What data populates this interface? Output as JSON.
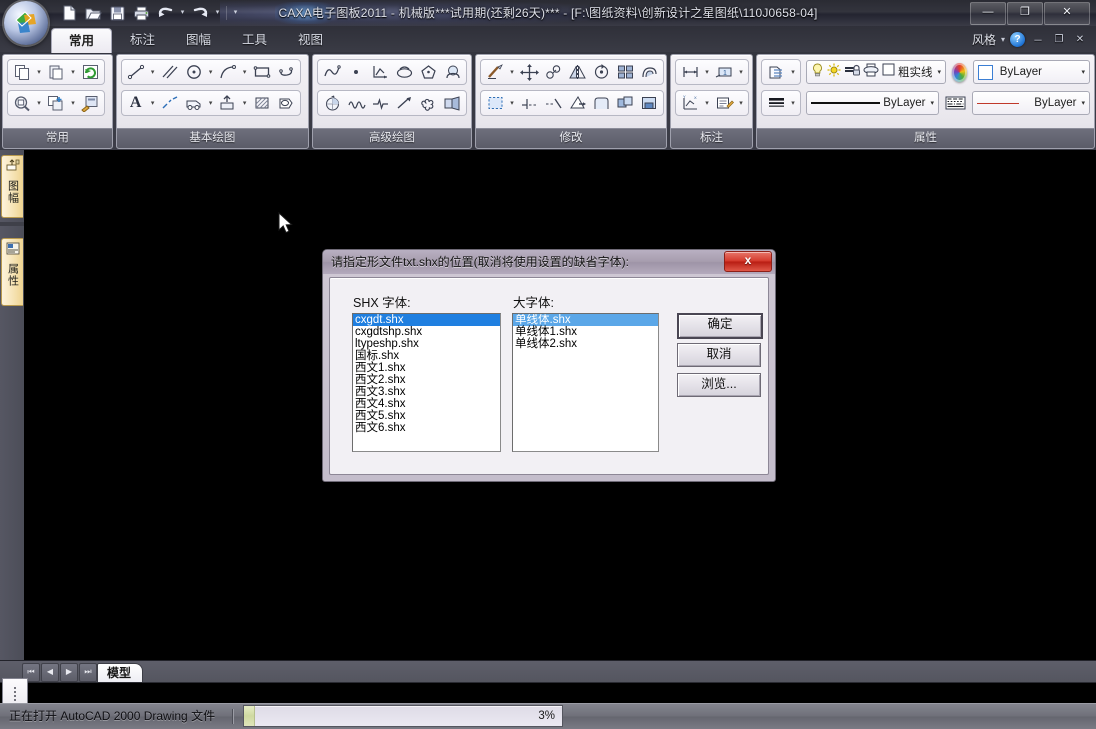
{
  "window": {
    "title": "CAXA电子图板2011 - 机械版***试用期(还剩26天)*** - [F:\\图纸资料\\创新设计之星图纸\\110J0658-04]",
    "minimize": "—",
    "restore": "❐",
    "close": "✕"
  },
  "quick_access": {
    "items": [
      {
        "name": "new-file-icon",
        "label": "新建"
      },
      {
        "name": "open-file-icon",
        "label": "打开"
      },
      {
        "name": "save-icon",
        "label": "保存"
      },
      {
        "name": "print-icon",
        "label": "打印"
      },
      {
        "name": "undo-icon",
        "label": "撤销"
      },
      {
        "name": "redo-icon",
        "label": "重做"
      },
      {
        "name": "customize-qat-icon",
        "label": "自定义快速访问工具栏"
      }
    ]
  },
  "ribbon": {
    "tabs": [
      {
        "label": "常用",
        "active": true
      },
      {
        "label": "标注",
        "active": false
      },
      {
        "label": "图幅",
        "active": false
      },
      {
        "label": "工具",
        "active": false
      },
      {
        "label": "视图",
        "active": false
      }
    ],
    "style_label": "风格",
    "help_label": "?",
    "minimize_ribbon": "－",
    "restore_ribbon": "❐",
    "close_ribbon": "✕",
    "panels": [
      {
        "title": "常用"
      },
      {
        "title": "基本绘图"
      },
      {
        "title": "高级绘图"
      },
      {
        "title": "修改"
      },
      {
        "title": "标注"
      },
      {
        "title": "属性"
      }
    ],
    "properties": {
      "layer_value": "粗实线",
      "color_value": "ByLayer",
      "linetype_value": "ByLayer",
      "lineweight_value": "ByLayer"
    }
  },
  "sidebar": {
    "tabs": [
      {
        "label": "图幅",
        "icon": "drawing-frame-icon"
      },
      {
        "label": "属性",
        "icon": "properties-icon"
      }
    ]
  },
  "dialog": {
    "title": "请指定形文件txt.shx的位置(取消将使用设置的缺省字体):",
    "close": "x",
    "shx_label": "SHX 字体:",
    "bigfont_label": "大字体:",
    "shx_fonts": [
      "cxgdt.shx",
      "cxgdtshp.shx",
      "ltypeshp.shx",
      "国标.shx",
      "西文1.shx",
      "西文2.shx",
      "西文3.shx",
      "西文4.shx",
      "西文5.shx",
      "西文6.shx"
    ],
    "shx_selected_index": 0,
    "big_fonts": [
      "单线体.shx",
      "单线体1.shx",
      "单线体2.shx"
    ],
    "big_selected_index": 0,
    "buttons": [
      {
        "label": "确定",
        "name": "ok-button",
        "default": true
      },
      {
        "label": "取消",
        "name": "cancel-button",
        "default": false
      },
      {
        "label": "浏览...",
        "name": "browse-button",
        "default": false
      }
    ]
  },
  "sheetbar": {
    "nav": [
      "⏮",
      "◀",
      "▶",
      "⏭"
    ],
    "tabs": [
      {
        "label": "模型",
        "active": true
      }
    ]
  },
  "statusbar": {
    "message": "正在打开 AutoCAD 2000 Drawing 文件",
    "progress_percent": 3,
    "progress_text": "3%"
  }
}
